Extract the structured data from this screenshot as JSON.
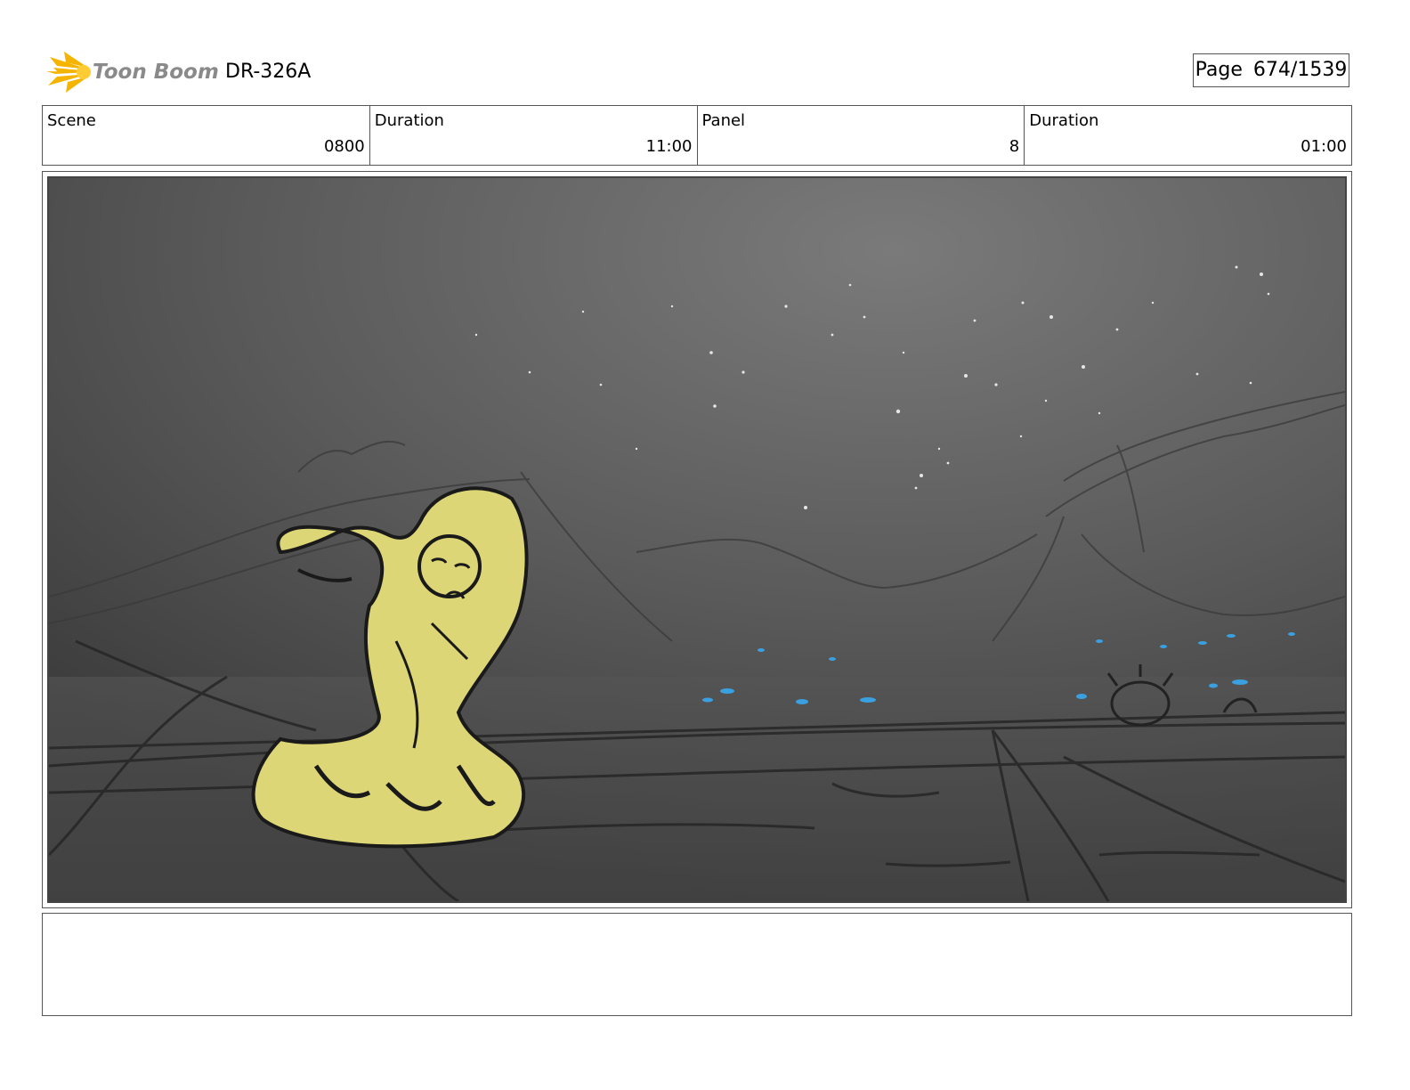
{
  "header": {
    "logo_text": "Toon Boom",
    "document_id": "DR-326A",
    "page_label": "Page",
    "page_number": "674/1539"
  },
  "info": {
    "scene_label": "Scene",
    "scene_value": "0800",
    "scene_duration_label": "Duration",
    "scene_duration_value": "11:00",
    "panel_label": "Panel",
    "panel_value": "8",
    "panel_duration_label": "Duration",
    "panel_duration_value": "01:00"
  },
  "notes": {
    "text": ""
  },
  "colors": {
    "logo_flare": "#f5b400",
    "character_fill": "#ddd676",
    "sky_light": "#7a7a7a",
    "sky_dark": "#3c3c3c",
    "glow_blue": "#3aa0e0"
  }
}
